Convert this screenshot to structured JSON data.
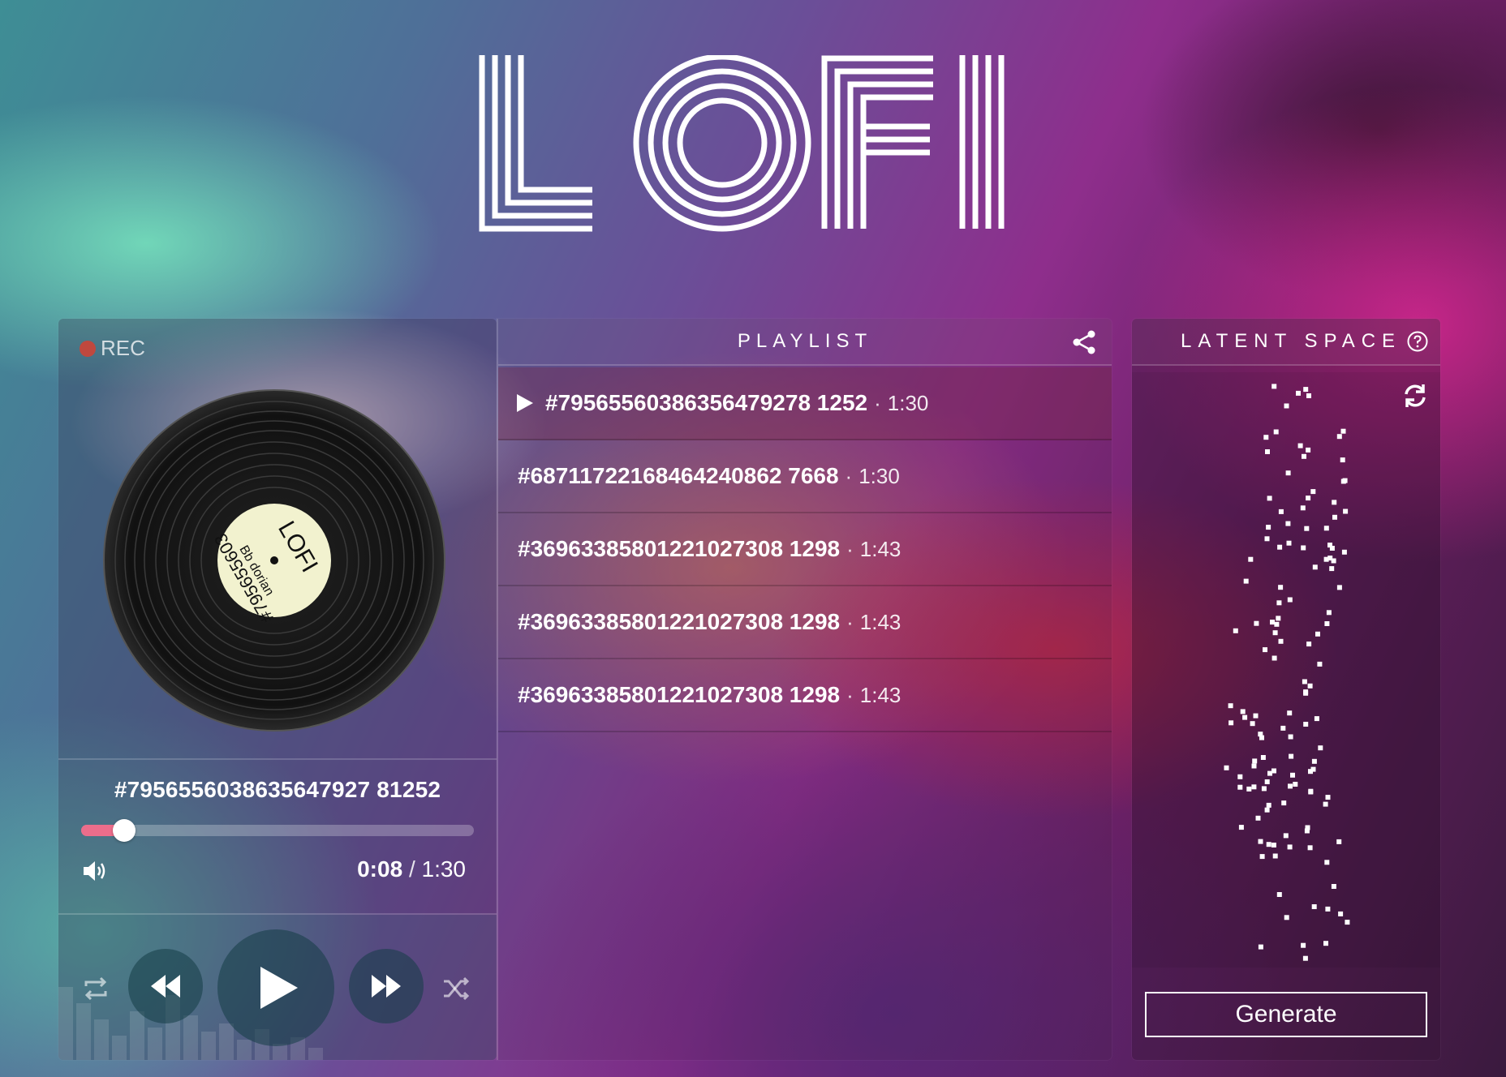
{
  "app": {
    "logo_text": "LOFI"
  },
  "player": {
    "rec_label": "REC",
    "disc": {
      "label_title": "LOFI",
      "label_key": "Bb dorian",
      "label_id": "#795655603"
    },
    "now_playing": "#7956556038635647927 81252",
    "progress_fraction": 0.11,
    "time_current": "0:08",
    "time_separator": "/",
    "time_total": "1:30",
    "icons": [
      "volume-icon",
      "repeat-icon",
      "rewind-icon",
      "play-icon",
      "fast-forward-icon",
      "shuffle-icon"
    ]
  },
  "playlist": {
    "title": "PLAYLIST",
    "tracks": [
      {
        "id": "#79565560386356479278 1252",
        "separator": "·",
        "duration": "1:30",
        "active": true
      },
      {
        "id": "#68711722168464240862 7668",
        "separator": "·",
        "duration": "1:30"
      },
      {
        "id": "#36963385801221027308 1298",
        "separator": "·",
        "duration": "1:43"
      },
      {
        "id": "#36963385801221027308 1298",
        "separator": "·",
        "duration": "1:43"
      },
      {
        "id": "#36963385801221027308 1298",
        "separator": "·",
        "duration": "1:43"
      }
    ]
  },
  "latent": {
    "title": "LATENT SPACE",
    "generate_label": "Generate"
  },
  "colors": {
    "accent": "#ec6d8b",
    "disc_label": "#f2f2cf",
    "rec": "#c0483e"
  }
}
